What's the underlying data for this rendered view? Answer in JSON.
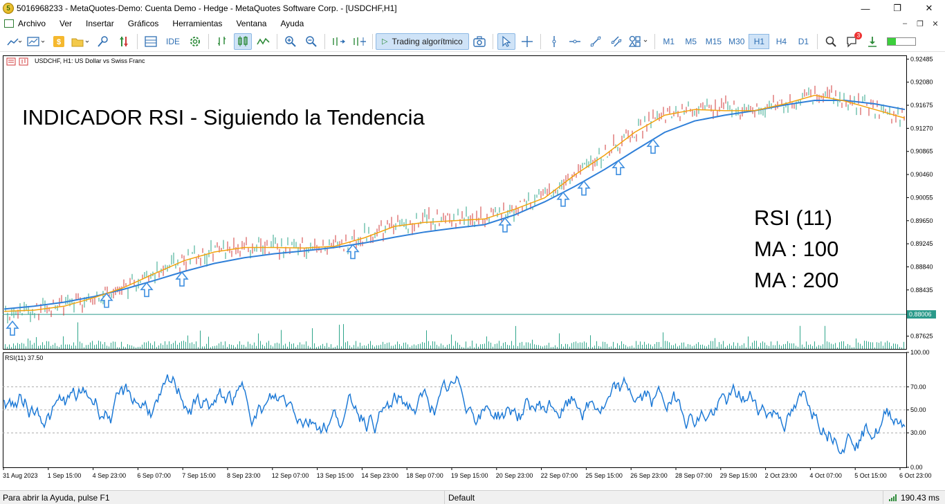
{
  "window": {
    "title": "5016968233 - MetaQuotes-Demo: Cuenta Demo - Hedge - MetaQuotes Software Corp. - [USDCHF,H1]",
    "icon_letter": "5",
    "controls": [
      "minimize-icon",
      "restore-icon",
      "close-icon"
    ]
  },
  "menu": {
    "items": [
      "Archivo",
      "Ver",
      "Insertar",
      "Gráficos",
      "Herramientas",
      "Ventana",
      "Ayuda"
    ]
  },
  "toolbar": {
    "ide_label": "IDE",
    "algo_label": "Trading algorítmico",
    "timeframes": [
      "M1",
      "M5",
      "M15",
      "M30",
      "H1",
      "H4",
      "D1"
    ],
    "active_timeframe": "H1",
    "notification_count": "3",
    "signal_level": 0.3
  },
  "chart": {
    "symbol_label": "USDCHF, H1:  US Dollar vs Swiss Franc",
    "headline": "INDICADOR RSI - Siguiendo la Tendencia",
    "note_lines": [
      "RSI (11)",
      "MA : 100",
      "MA : 200"
    ],
    "current_price": "0.88006",
    "rsi_label": "RSI(11) 37.50",
    "colors": {
      "ma_fast": "#f2a20c",
      "ma_slow": "#2f7fd8",
      "rsi": "#1e7ad6",
      "arrow": "#3f8fe0",
      "volume": "#2ea58a",
      "candle_up": "#2ea58a",
      "candle_down": "#d03a3a"
    }
  },
  "chart_data": {
    "type": "line",
    "price_axis_ticks": [
      "0.92485",
      "0.92080",
      "0.91675",
      "0.91270",
      "0.90865",
      "0.90460",
      "0.90055",
      "0.89650",
      "0.89245",
      "0.88840",
      "0.88435",
      "0.87625"
    ],
    "rsi_axis_ticks": [
      "100.00",
      "70.00",
      "50.00",
      "30.00",
      "0.00"
    ],
    "time_axis_ticks": [
      "31 Aug 2023",
      "1 Sep 15:00",
      "4 Sep 23:00",
      "6 Sep 07:00",
      "7 Sep 15:00",
      "8 Sep 23:00",
      "12 Sep 07:00",
      "13 Sep 15:00",
      "14 Sep 23:00",
      "18 Sep 07:00",
      "19 Sep 15:00",
      "20 Sep 23:00",
      "22 Sep 07:00",
      "25 Sep 15:00",
      "26 Sep 23:00",
      "28 Sep 07:00",
      "29 Sep 15:00",
      "2 Oct 23:00",
      "4 Oct 07:00",
      "5 Oct 15:00",
      "6 Oct 23:00"
    ],
    "ylim": [
      0.874,
      0.9255
    ],
    "rsi_ylim": [
      0,
      100
    ],
    "rsi_levels": [
      70,
      50,
      30
    ],
    "series": [
      {
        "values": [
          0.8806,
          0.8808,
          0.8815,
          0.883,
          0.8848,
          0.8872,
          0.8895,
          0.891,
          0.8918,
          0.8918,
          0.8917,
          0.892,
          0.8935,
          0.8955,
          0.8962,
          0.8965,
          0.8968,
          0.8985,
          0.9005,
          0.9045,
          0.908,
          0.912,
          0.915,
          0.916,
          0.9158,
          0.9158,
          0.917,
          0.9185,
          0.9175,
          0.916,
          0.9145
        ]
      },
      {
        "values": [
          0.881,
          0.8815,
          0.8822,
          0.8832,
          0.8845,
          0.886,
          0.8876,
          0.889,
          0.89,
          0.8907,
          0.8912,
          0.8918,
          0.8926,
          0.8936,
          0.8945,
          0.8952,
          0.8958,
          0.8975,
          0.8998,
          0.9025,
          0.9055,
          0.9088,
          0.912,
          0.914,
          0.915,
          0.9158,
          0.9168,
          0.9176,
          0.9176,
          0.917,
          0.916
        ]
      }
    ],
    "current_price_value": 0.88006
  }
}
